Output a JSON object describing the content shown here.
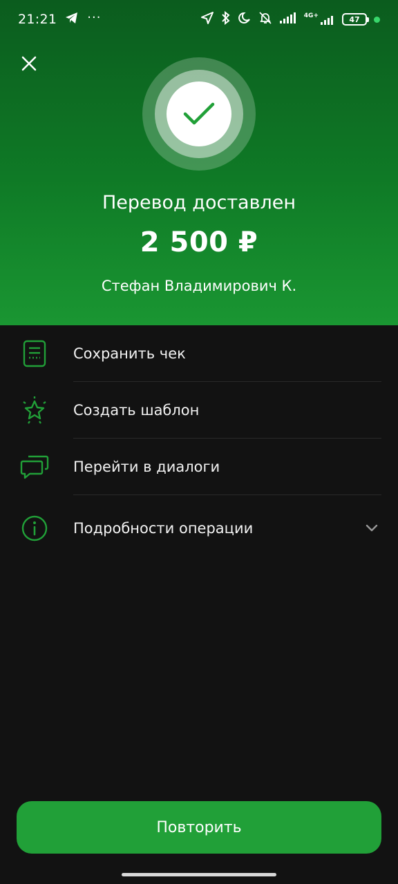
{
  "status_bar": {
    "time": "21:21",
    "dots": "···",
    "network_label": "4G+",
    "battery": "47"
  },
  "header": {
    "close_icon": "close-icon",
    "success_icon": "checkmark-icon",
    "title": "Перевод доставлен",
    "amount": "2 500 ₽",
    "recipient": "Стефан Владимирович К."
  },
  "actions": [
    {
      "label": "Сохранить чек",
      "icon": "receipt-icon"
    },
    {
      "label": "Создать шаблон",
      "icon": "star-icon"
    },
    {
      "label": "Перейти в диалоги",
      "icon": "chat-icon"
    },
    {
      "label": "Подробности операции",
      "icon": "info-icon",
      "expand_icon": "chevron-down-icon"
    }
  ],
  "footer": {
    "repeat_label": "Повторить"
  },
  "colors": {
    "accent": "#21a038",
    "background": "#121212",
    "hero_top": "#0b5c1e",
    "hero_bottom": "#1a9632"
  }
}
